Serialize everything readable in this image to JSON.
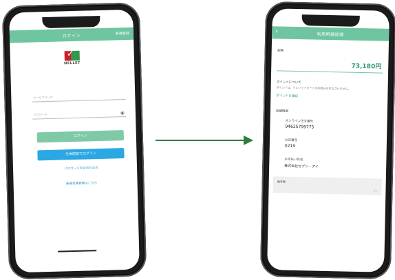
{
  "login_screen": {
    "header_title": "ログイン",
    "header_action": "新規登録",
    "logo_text": "NELLET",
    "email_placeholder": "メールアドレス",
    "password_placeholder": "パスワード",
    "eye_icon": "eye-icon",
    "login_button": "ログイン",
    "biometric_button": "生体認証でログイン",
    "forgot_link": "パスワードをお忘れの方",
    "register_link": "新規会員登録はこちら"
  },
  "detail_screen": {
    "header_title": "利用明細詳細",
    "back_icon": "chevron-left-icon",
    "amount_label": "金額",
    "amount_value": "73,180円",
    "points_heading": "ポイントについて",
    "points_note": "ポイントは、クレジットカードの利用分は付与されません。",
    "points_link": "ポイントを確認",
    "store_heading": "店舗情報",
    "store_number_label": "オンライン注文番号",
    "store_number_value": "94625799775",
    "code_label": "お店番号",
    "code_value": "0219",
    "company_label": "お支払い先名",
    "company_value": "株式会社セブン・アイ",
    "card_title": "備考欄",
    "card_sub": "なし"
  },
  "colors": {
    "accent": "#6ec5a0",
    "blue_button": "#2aa8e3",
    "arrow": "#2e7d3a"
  }
}
